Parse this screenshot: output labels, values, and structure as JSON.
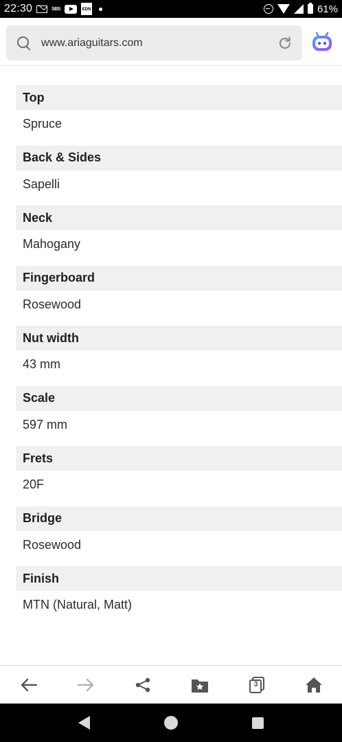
{
  "status_bar": {
    "time": "22:30",
    "sbs_label": "SBS",
    "edn_label": "EDN",
    "battery_percent": "61%",
    "icons": [
      "mail-icon",
      "sbs-news-icon",
      "youtube-icon",
      "edn-app-icon",
      "notification-dot-icon",
      "dnd-icon",
      "wifi-icon",
      "signal-icon",
      "battery-icon"
    ]
  },
  "browser": {
    "url": "www.ariaguitars.com",
    "icons": [
      "search-icon",
      "reload-icon",
      "assistant-bot-icon"
    ]
  },
  "specs": [
    {
      "label": "Top",
      "value": "Spruce"
    },
    {
      "label": "Back & Sides",
      "value": "Sapelli"
    },
    {
      "label": "Neck",
      "value": "Mahogany"
    },
    {
      "label": "Fingerboard",
      "value": "Rosewood"
    },
    {
      "label": "Nut width",
      "value": "43 mm"
    },
    {
      "label": "Scale",
      "value": "597 mm"
    },
    {
      "label": "Frets",
      "value": "20F"
    },
    {
      "label": "Bridge",
      "value": "Rosewood"
    },
    {
      "label": "Finish",
      "value": "MTN (Natural, Matt)"
    }
  ],
  "toolbar": {
    "tab_count": "3",
    "icons": [
      "back-arrow-icon",
      "forward-arrow-icon",
      "share-icon",
      "bookmarks-icon",
      "tabs-icon",
      "home-icon"
    ]
  },
  "colors": {
    "label_background": "#f0f0f0",
    "status_bar": "#000000",
    "url_box": "#ececec",
    "bot_accent": "#7b5cff"
  }
}
